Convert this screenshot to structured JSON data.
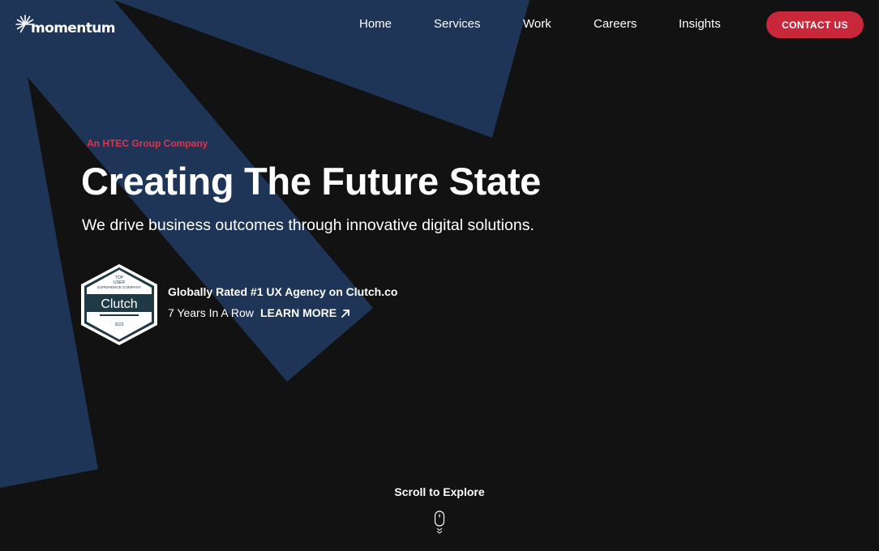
{
  "brand": {
    "logo_text": "momentum"
  },
  "nav": {
    "items": [
      {
        "label": "Home"
      },
      {
        "label": "Services"
      },
      {
        "label": "Work"
      },
      {
        "label": "Careers"
      },
      {
        "label": "Insights"
      }
    ],
    "cta_label": "CONTACT US"
  },
  "hero": {
    "eyebrow": "An HTEC Group Company",
    "headline": "Creating The Future State",
    "subhead": "We drive business outcomes through innovative digital solutions."
  },
  "badge": {
    "top": "TOP",
    "line1": "USER",
    "line2": "EXPERIENCE COMPANY",
    "name": "Clutch",
    "year": "2023"
  },
  "rating": {
    "title": "Globally Rated #1 UX Agency on Clutch.co",
    "subtitle": "7 Years In A Row",
    "link_label": "LEARN MORE"
  },
  "scroll": {
    "label": "Scroll to Explore"
  },
  "colors": {
    "background": "#121212",
    "shape_blue": "#1e3558",
    "accent_red": "#c8283a",
    "eyebrow_red": "#e0334a",
    "badge_dark": "#1f3a44"
  }
}
